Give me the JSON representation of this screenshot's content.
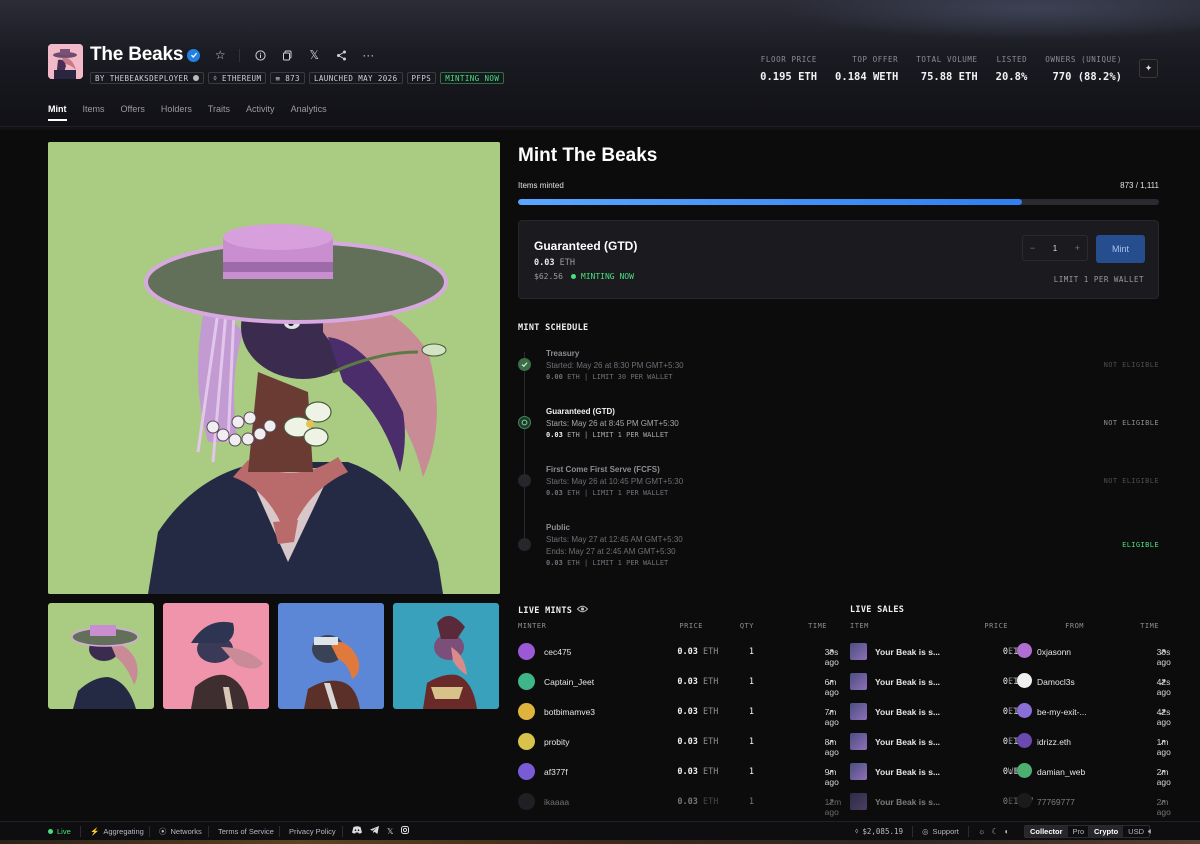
{
  "collection": {
    "name": "The Beaks",
    "creator": "BY THEBEAKSDEPLOYER",
    "chain": "ETHEREUM",
    "item_count": "873",
    "launched": "LAUNCHED MAY 2026",
    "category": "PFPS",
    "status": "MINTING NOW"
  },
  "stats": [
    {
      "label": "FLOOR PRICE",
      "value": "0.195 ETH"
    },
    {
      "label": "TOP OFFER",
      "value": "0.184 WETH"
    },
    {
      "label": "TOTAL VOLUME",
      "value": "75.88 ETH"
    },
    {
      "label": "LISTED",
      "value": "20.8%"
    },
    {
      "label": "OWNERS (UNIQUE)",
      "value": "770 (88.2%)"
    }
  ],
  "tabs": [
    "Mint",
    "Items",
    "Offers",
    "Holders",
    "Traits",
    "Activity",
    "Analytics"
  ],
  "mint": {
    "title": "Mint The Beaks",
    "items_minted_label": "Items minted",
    "items_minted_value": "873 / 1,111",
    "progress": 0.786,
    "stage": {
      "name": "Guaranteed (GTD)",
      "price": "0.03",
      "currency": "ETH",
      "usd": "$62.56",
      "status": "MINTING NOW",
      "quantity": "1",
      "minus": "−",
      "plus": "+",
      "button": "Mint",
      "limit": "LIMIT 1 PER WALLET"
    }
  },
  "schedule": {
    "heading": "MINT SCHEDULE",
    "phases": [
      {
        "name": "Treasury",
        "line1": "Started: May 26 at 8:30 PM GMT+5:30",
        "price": "0.00",
        "currency": "ETH",
        "limit": "LIMIT 30 PER WALLET",
        "eligibility": "NOT ELIGIBLE"
      },
      {
        "name": "Guaranteed (GTD)",
        "line1": "Starts: May 26 at 8:45 PM GMT+5:30",
        "price": "0.03",
        "currency": "ETH",
        "limit": "LIMIT 1 PER WALLET",
        "eligibility": "NOT ELIGIBLE"
      },
      {
        "name": "First Come First Serve (FCFS)",
        "line1": "Starts: May 26 at 10:45 PM GMT+5:30",
        "price": "0.03",
        "currency": "ETH",
        "limit": "LIMIT 1 PER WALLET",
        "eligibility": "NOT ELIGIBLE"
      },
      {
        "name": "Public",
        "line1": "Starts: May 27 at 12:45 AM GMT+5:30",
        "line2": "Ends: May 27 at 2:45 AM GMT+5:30",
        "price": "0.03",
        "currency": "ETH",
        "limit": "LIMIT 1 PER WALLET",
        "eligibility": "ELIGIBLE"
      }
    ]
  },
  "live_mints": {
    "heading": "LIVE MINTS",
    "columns": [
      "MINTER",
      "PRICE",
      "QTY",
      "TIME"
    ],
    "rows": [
      {
        "minter": "cec475",
        "price": "0.03",
        "currency": "ETH",
        "qty": "1",
        "time": "30s ago",
        "color": "#9b59d6"
      },
      {
        "minter": "Captain_Jeet",
        "price": "0.03",
        "currency": "ETH",
        "qty": "1",
        "time": "6m ago",
        "color": "#3fb58a"
      },
      {
        "minter": "botbimamve3",
        "price": "0.03",
        "currency": "ETH",
        "qty": "1",
        "time": "7m ago",
        "color": "#e0b43c"
      },
      {
        "minter": "probity",
        "price": "0.03",
        "currency": "ETH",
        "qty": "1",
        "time": "8m ago",
        "color": "#d9c24a"
      },
      {
        "minter": "af377f",
        "price": "0.03",
        "currency": "ETH",
        "qty": "1",
        "time": "9m ago",
        "color": "#7a5bd6"
      },
      {
        "minter": "ikaaaa",
        "price": "0.03",
        "currency": "ETH",
        "qty": "1",
        "time": "12m ago",
        "color": "#3a3a40"
      }
    ]
  },
  "live_sales": {
    "heading": "LIVE SALES",
    "columns": [
      "ITEM",
      "PRICE",
      "FROM",
      "TIME"
    ],
    "rows": [
      {
        "item": "Your Beak is s...",
        "price": "0.195",
        "currency": "ETH",
        "from": "0xjasonn",
        "time": "30s ago",
        "color": "#b06fd0"
      },
      {
        "item": "Your Beak is s...",
        "price": "0.195",
        "currency": "ETH",
        "from": "Damocl3s",
        "time": "42s ago",
        "color": "#f0f0f0"
      },
      {
        "item": "Your Beak is s...",
        "price": "0.197",
        "currency": "ETH",
        "from": "be-my-exit-...",
        "time": "42s ago",
        "color": "#8a6fd8"
      },
      {
        "item": "Your Beak is s...",
        "price": "0.195",
        "currency": "ETH",
        "from": "idrizz.eth",
        "time": "1m ago",
        "color": "#6a4ab0"
      },
      {
        "item": "Your Beak is s...",
        "price": "0.183",
        "currency": "WETH",
        "from": "damian_web",
        "time": "2m ago",
        "color": "#4caf70"
      },
      {
        "item": "Your Beak is s...",
        "price": "0.1967",
        "currency": "ETH",
        "from": "77769777",
        "time": "2m ago",
        "color": "#2a2a2e"
      }
    ]
  },
  "status_bar": {
    "live": "Live",
    "aggregating": "Aggregating",
    "networks": "Networks",
    "terms": "Terms of Service",
    "privacy": "Privacy Policy",
    "eth_price": "$2,085.19",
    "support": "Support",
    "collector": "Collector",
    "pro": "Pro",
    "crypto": "Crypto",
    "usd": "USD"
  },
  "colors": {
    "accent": "#2081e2",
    "green": "#4ade80",
    "progress": "#3b86f0",
    "artwork_bg": "#a9cc82"
  }
}
